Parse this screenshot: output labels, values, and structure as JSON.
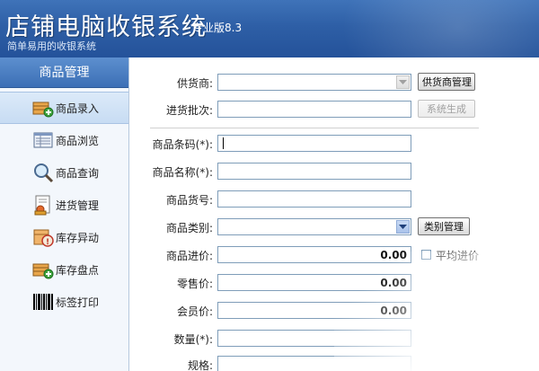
{
  "header": {
    "title": "店铺电脑收银系统",
    "subtitle": "简单易用的收银系统",
    "version": "专业版8.3"
  },
  "sidebar": {
    "title": "商品管理",
    "items": [
      {
        "label": "商品录入",
        "icon": "product-entry-icon",
        "active": true
      },
      {
        "label": "商品浏览",
        "icon": "product-browse-icon",
        "active": false
      },
      {
        "label": "商品查询",
        "icon": "magnifier-icon",
        "active": false
      },
      {
        "label": "进货管理",
        "icon": "purchase-icon",
        "active": false
      },
      {
        "label": "库存异动",
        "icon": "stock-change-icon",
        "active": false
      },
      {
        "label": "库存盘点",
        "icon": "stock-count-icon",
        "active": false
      },
      {
        "label": "标签打印",
        "icon": "barcode-icon",
        "active": false
      }
    ]
  },
  "form": {
    "supplier_label": "供货商:",
    "supplier_value": "",
    "supplier_button": "供货商管理",
    "batch_label": "进货批次:",
    "batch_value": "",
    "batch_button": "系统生成",
    "barcode_label": "商品条码(*):",
    "barcode_value": "",
    "name_label": "商品名称(*):",
    "name_value": "",
    "sku_label": "商品货号:",
    "sku_value": "",
    "category_label": "商品类别:",
    "category_value": "",
    "category_button": "类别管理",
    "cost_label": "商品进价:",
    "cost_value": "0.00",
    "avg_cost_label": "平均进价",
    "retail_label": "零售价:",
    "retail_value": "0.00",
    "member_label": "会员价:",
    "member_value": "0.00",
    "qty_label": "数量(*):",
    "qty_value": "",
    "spec_label": "规格:",
    "spec_value": ""
  },
  "colors": {
    "header": "#2e5fa6",
    "sidebar_header": "#4a7cc0",
    "active_item": "#cfe0f5",
    "input_border": "#7f9db9"
  }
}
